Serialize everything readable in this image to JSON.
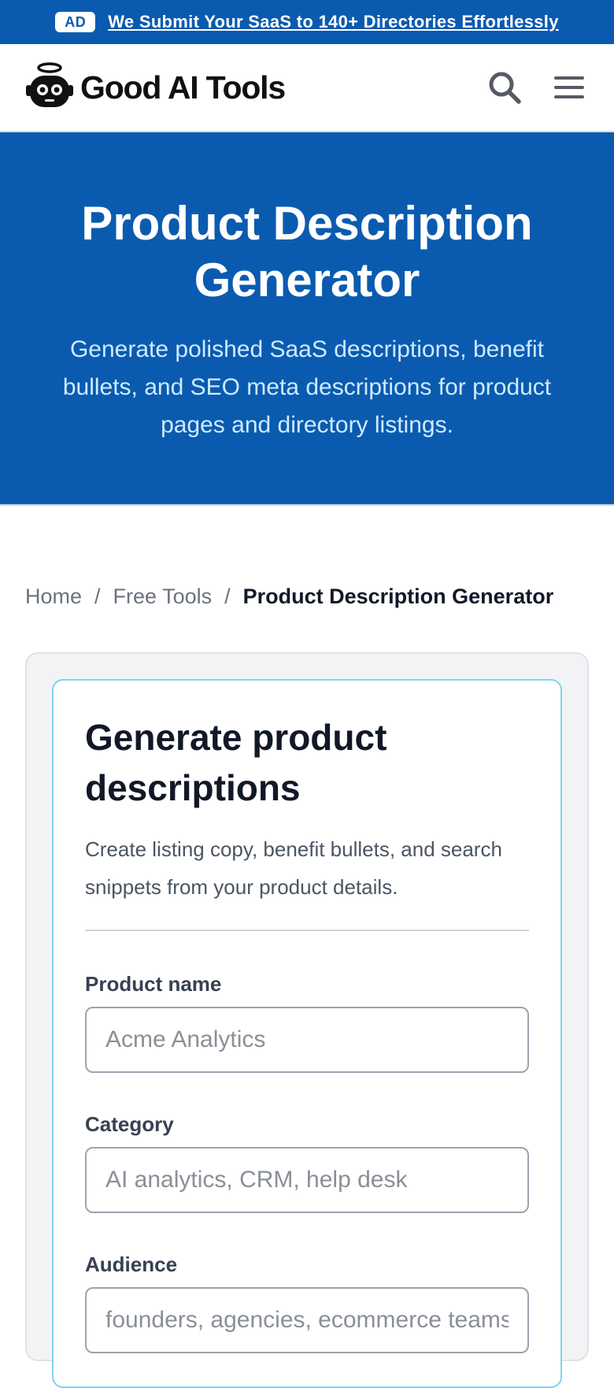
{
  "ad": {
    "badge": "AD",
    "link_text": "We Submit Your SaaS to 140+ Directories Effortlessly"
  },
  "header": {
    "brand": "Good AI Tools",
    "icons": {
      "search": "search-icon",
      "menu": "hamburger-menu-icon",
      "logo": "robot-halo-icon"
    }
  },
  "hero": {
    "title": "Product Description Generator",
    "subtitle": "Generate polished SaaS descriptions, benefit bullets, and SEO meta descriptions for product pages and directory listings."
  },
  "breadcrumb": {
    "items": [
      "Home",
      "Free Tools"
    ],
    "current": "Product Description Generator",
    "separator": "/"
  },
  "form": {
    "title": "Generate product descriptions",
    "description": "Create listing copy, benefit bullets, and search snippets from your product details.",
    "fields": [
      {
        "label": "Product name",
        "placeholder": "Acme Analytics",
        "value": ""
      },
      {
        "label": "Category",
        "placeholder": "AI analytics, CRM, help desk",
        "value": ""
      },
      {
        "label": "Audience",
        "placeholder": "founders, agencies, ecommerce teams",
        "value": ""
      }
    ]
  },
  "colors": {
    "brand_blue": "#0a5bb0",
    "hero_subtitle": "#cfeaff",
    "card_border": "#7fd3f0"
  }
}
